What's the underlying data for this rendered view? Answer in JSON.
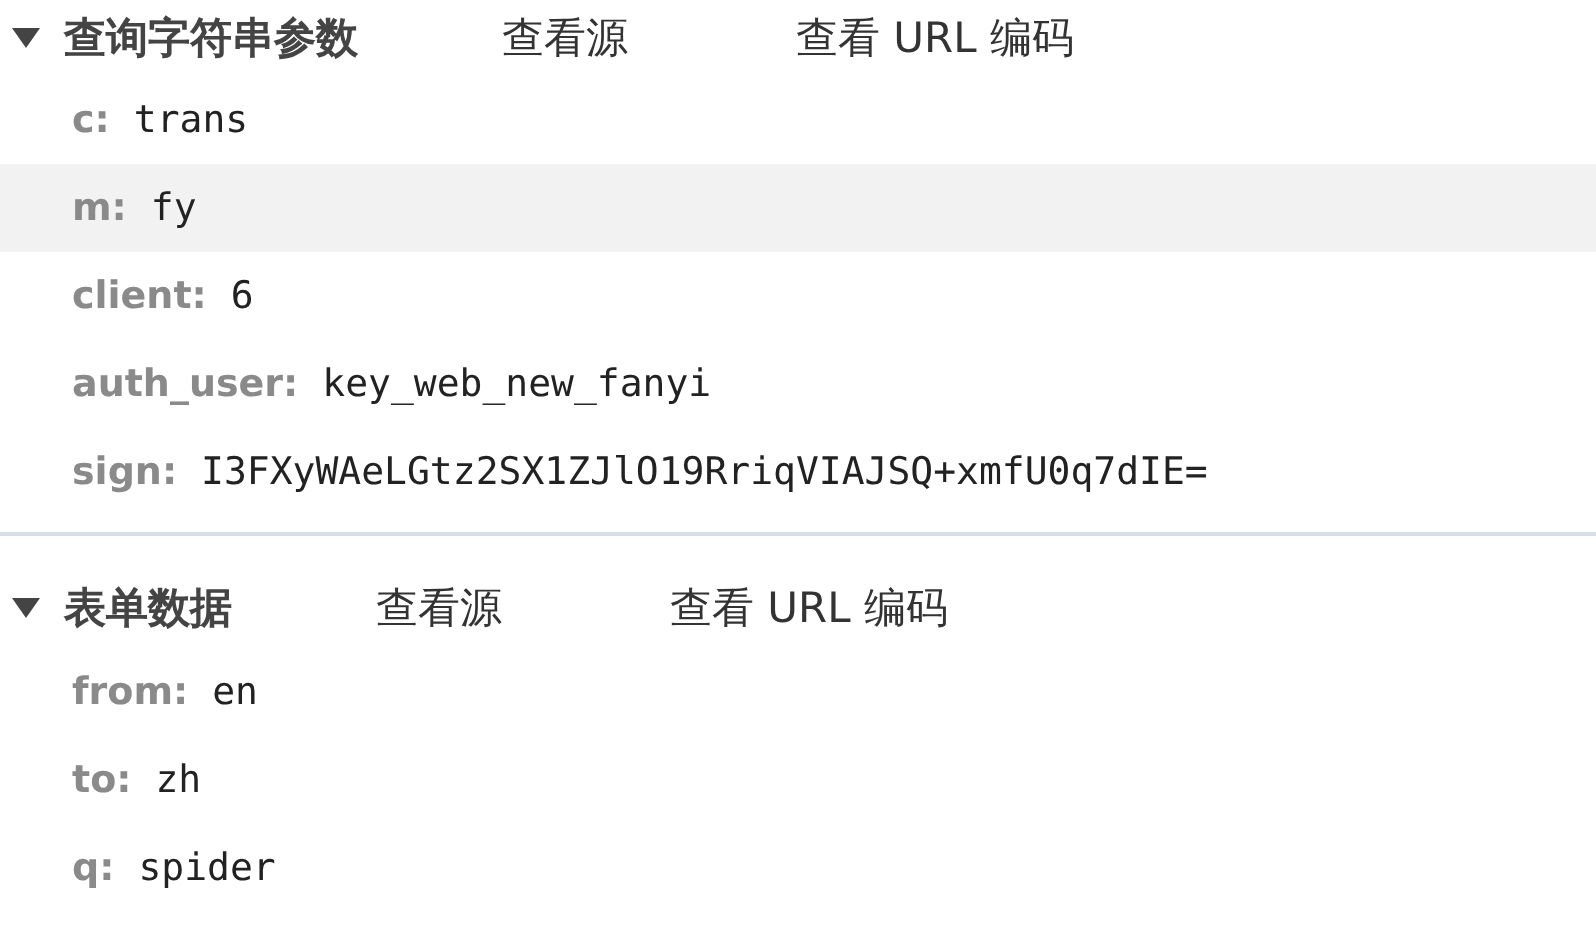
{
  "sections": [
    {
      "title": "查询字符串参数",
      "expanded": true,
      "links": [
        "查看源",
        "查看 URL 编码"
      ],
      "params": [
        {
          "key": "c:",
          "value": "trans",
          "highlighted": false
        },
        {
          "key": "m:",
          "value": "fy",
          "highlighted": true
        },
        {
          "key": "client:",
          "value": "6",
          "highlighted": false
        },
        {
          "key": "auth_user:",
          "value": "key_web_new_fanyi",
          "highlighted": false
        },
        {
          "key": "sign:",
          "value": "I3FXyWAeLGtz2SX1ZJlO19RriqVIAJSQ+xmfU0q7dIE=",
          "highlighted": false
        }
      ]
    },
    {
      "title": "表单数据",
      "expanded": true,
      "links": [
        "查看源",
        "查看 URL 编码"
      ],
      "params": [
        {
          "key": "from:",
          "value": "en",
          "highlighted": false
        },
        {
          "key": "to:",
          "value": "zh",
          "highlighted": false
        },
        {
          "key": "q:",
          "value": "spider",
          "highlighted": false
        }
      ]
    }
  ]
}
